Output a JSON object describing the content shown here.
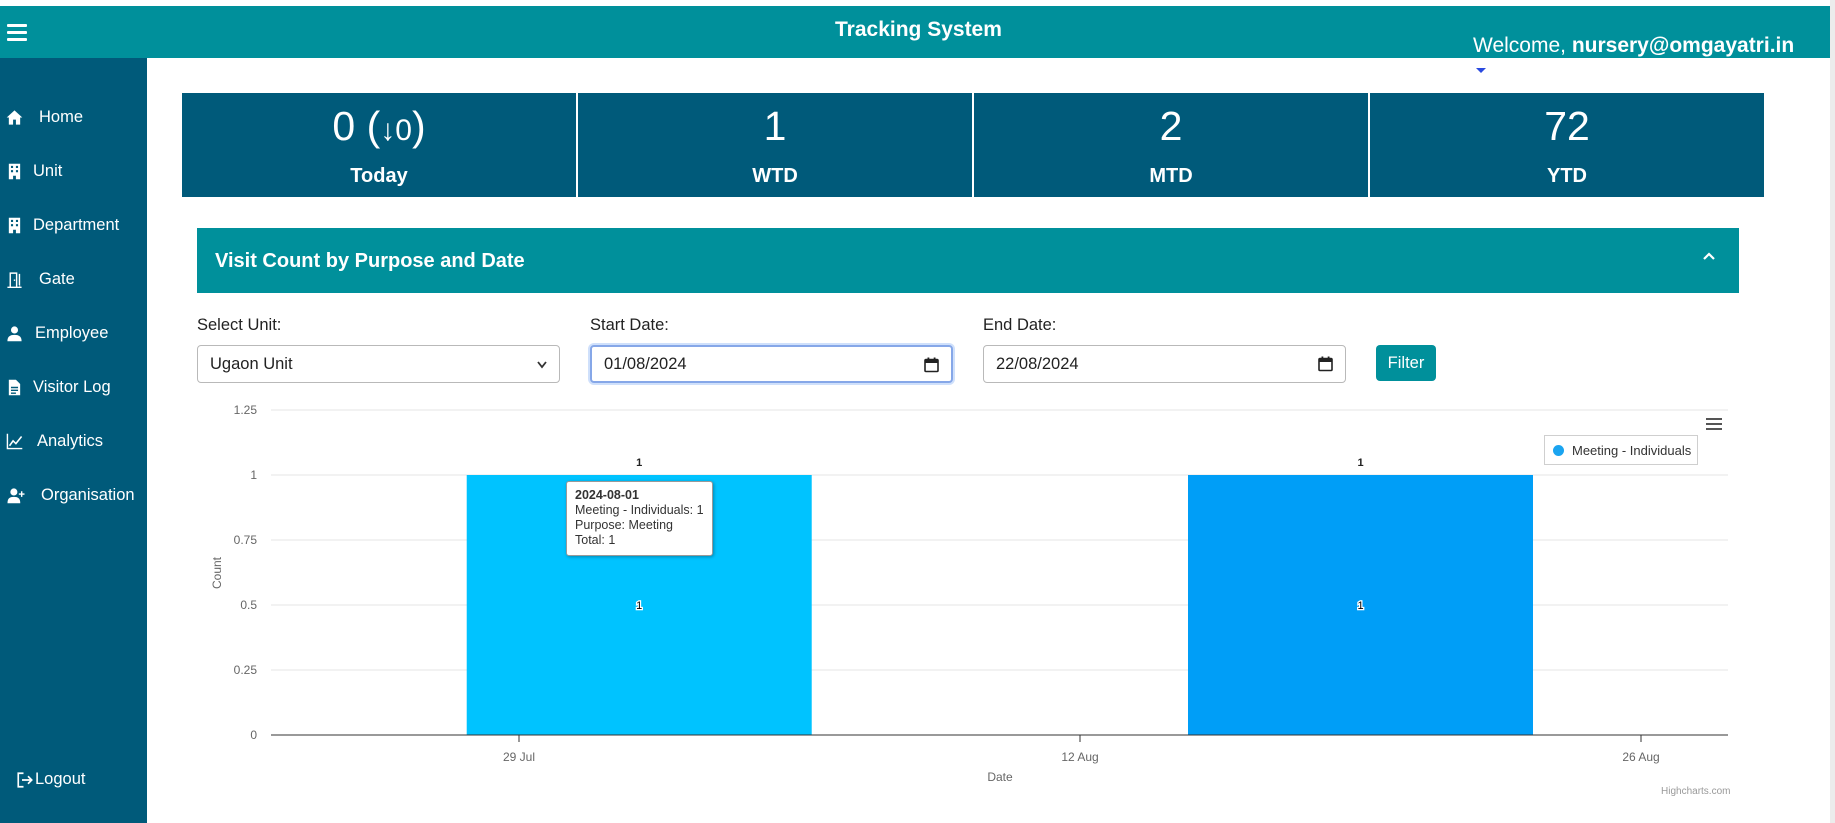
{
  "header": {
    "title": "Tracking System",
    "welcome_prefix": "Welcome, ",
    "user_email": "nursery@omgayatri.in"
  },
  "sidebar": {
    "items": [
      {
        "label": "Home",
        "icon": "home-icon"
      },
      {
        "label": "Unit",
        "icon": "building-icon"
      },
      {
        "label": "Department",
        "icon": "building-icon"
      },
      {
        "label": "Gate",
        "icon": "door-icon"
      },
      {
        "label": "Employee",
        "icon": "user-icon"
      },
      {
        "label": "Visitor Log",
        "icon": "document-icon"
      },
      {
        "label": "Analytics",
        "icon": "line-chart-icon"
      },
      {
        "label": "Organisation",
        "icon": "user-plus-icon"
      }
    ],
    "logout": "Logout"
  },
  "stats": [
    {
      "value": "0 (",
      "arrow": "↓0",
      "close": ")",
      "caption": "Today"
    },
    {
      "value": "1",
      "caption": "WTD"
    },
    {
      "value": "2",
      "caption": "MTD"
    },
    {
      "value": "72",
      "caption": "YTD"
    }
  ],
  "panel": {
    "title": "Visit Count by Purpose and Date",
    "collapse_icon": "chevron-up-icon"
  },
  "filters": {
    "unit_label": "Select Unit:",
    "unit_value": "Ugaon Unit",
    "start_label": "Start Date:",
    "start_value": "01/08/2024",
    "end_label": "End Date:",
    "end_value": "22/08/2024",
    "filter_button": "Filter"
  },
  "chart_data": {
    "type": "bar",
    "ylabel": "Count",
    "xlabel": "Date",
    "ylim": [
      0,
      1.25
    ],
    "y_ticks": [
      "0",
      "0.25",
      "0.5",
      "0.75",
      "1",
      "1.25"
    ],
    "x_ticks": [
      "29 Jul",
      "12 Aug",
      "26 Aug"
    ],
    "series": [
      {
        "name": "Meeting - Individuals",
        "points": [
          {
            "x": "2024-08-01",
            "y": 1
          },
          {
            "x": "2024-08-19",
            "y": 1
          }
        ]
      }
    ],
    "data_labels": [
      "1",
      "1"
    ],
    "inner_labels": [
      "1",
      "1"
    ],
    "legend_position": "top-right",
    "colors": {
      "bar1": "#00c3ff",
      "bar2": "#009ef7",
      "legend_dot": "#1aa4f0"
    },
    "tooltip": {
      "title": "2024-08-01",
      "line1": "Meeting - Individuals: 1",
      "line2": "Purpose: Meeting",
      "line3": "Total: 1"
    },
    "credit": "Highcharts.com"
  }
}
